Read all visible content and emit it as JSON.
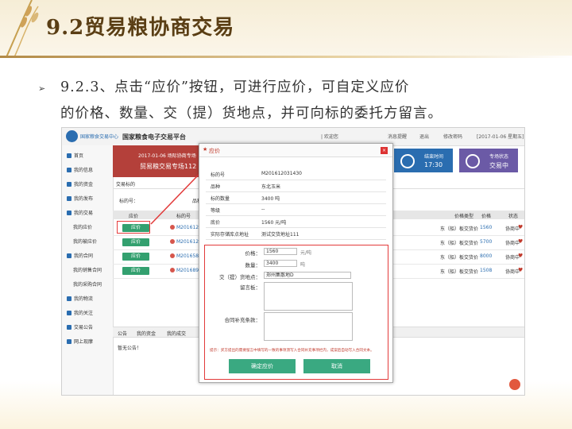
{
  "slide": {
    "title": "9.2贸易粮协商交易",
    "bullet": "➢",
    "line1": "9.2.3、点击“应价”按钮，可进行应价，可自定义应价",
    "line2": "的价格、数量、交（提）货地点，并可向标的委托方留言。"
  },
  "app": {
    "logo_text": "国家粮食交易中心",
    "platform_name": "国家粮食电子交易平台",
    "header_welcome": "| 欢迎您",
    "header_messages": "消息提醒",
    "header_exit": "退出",
    "header_change_pwd": "修改密码",
    "header_date": "[2017-01-06 星期五]",
    "sidebar": [
      {
        "label": "首页"
      },
      {
        "label": "我的信息"
      },
      {
        "label": "我的资金"
      },
      {
        "label": "我的发布"
      },
      {
        "label": "我的交易"
      },
      {
        "label": "我的应价",
        "sub": true
      },
      {
        "label": "我的被应价",
        "sub": true
      },
      {
        "label": "我的合同"
      },
      {
        "label": "我的销售合同",
        "sub": true
      },
      {
        "label": "我的采购合同",
        "sub": true
      },
      {
        "label": "我的物流"
      },
      {
        "label": "我的关注"
      },
      {
        "label": "交易公告"
      },
      {
        "label": "网上现摩"
      }
    ],
    "banner": {
      "date_line": "2017-01-06  场际协商专场",
      "session": "贸易粮交易专场112"
    },
    "tile_end_time": {
      "label": "结束时间",
      "value": "17:30"
    },
    "tile_status": {
      "label": "专场状态",
      "value": "交易中"
    },
    "tab_label": "交易标的",
    "search_label": "标的号：",
    "search_label2": "品种",
    "table_headers": {
      "offer": "应价",
      "id": "标的号",
      "price_type": "价格类型",
      "price": "价格",
      "status": "状态"
    },
    "rows": [
      {
        "btn": "应价",
        "id": "M2016120314",
        "price_type": "东（船）板交货价",
        "price": "1560",
        "status": "协商中"
      },
      {
        "btn": "应价",
        "id": "M2016120314",
        "price_type": "东（船）板交货价",
        "price": "5700",
        "status": "协商中"
      },
      {
        "btn": "应价",
        "id": "M2016585512",
        "price_type": "东（船）板交货价",
        "price": "8000",
        "status": "协商中"
      },
      {
        "btn": "应价",
        "id": "M2016895224",
        "price_type": "东（船）板交货价",
        "price": "1508",
        "status": "协商中"
      }
    ],
    "bottom_tabs": [
      "公告",
      "我的资金",
      "我的成交"
    ],
    "notice": "暂无公告！"
  },
  "modal": {
    "title": "应价",
    "info": [
      {
        "k": "标的号",
        "v": "M201612031430"
      },
      {
        "k": "品种",
        "v": "东北玉米"
      },
      {
        "k": "标的数量",
        "v": "3400 吨"
      },
      {
        "k": "等级",
        "v": "--"
      },
      {
        "k": "底价",
        "v": "1560 元/吨"
      },
      {
        "k": "实际存储库点地址",
        "v": "测试交货地址111"
      }
    ],
    "form": {
      "price_label": "价格：",
      "price_value": "1560",
      "price_unit": "元/吨",
      "qty_label": "数量：",
      "qty_value": "3400",
      "qty_unit": "吨",
      "place_label": "交（提）货地点：",
      "place_value": "郑州集散地D",
      "message_label": "留言板：",
      "supplement_label": "合同补充条款："
    },
    "tip": "提示：买方提出的需要留言中填写的一致的事项须写入合同补充事项栏内，成案后自动写入合同文本。",
    "confirm_label": "确定应价",
    "cancel_label": "取消"
  }
}
